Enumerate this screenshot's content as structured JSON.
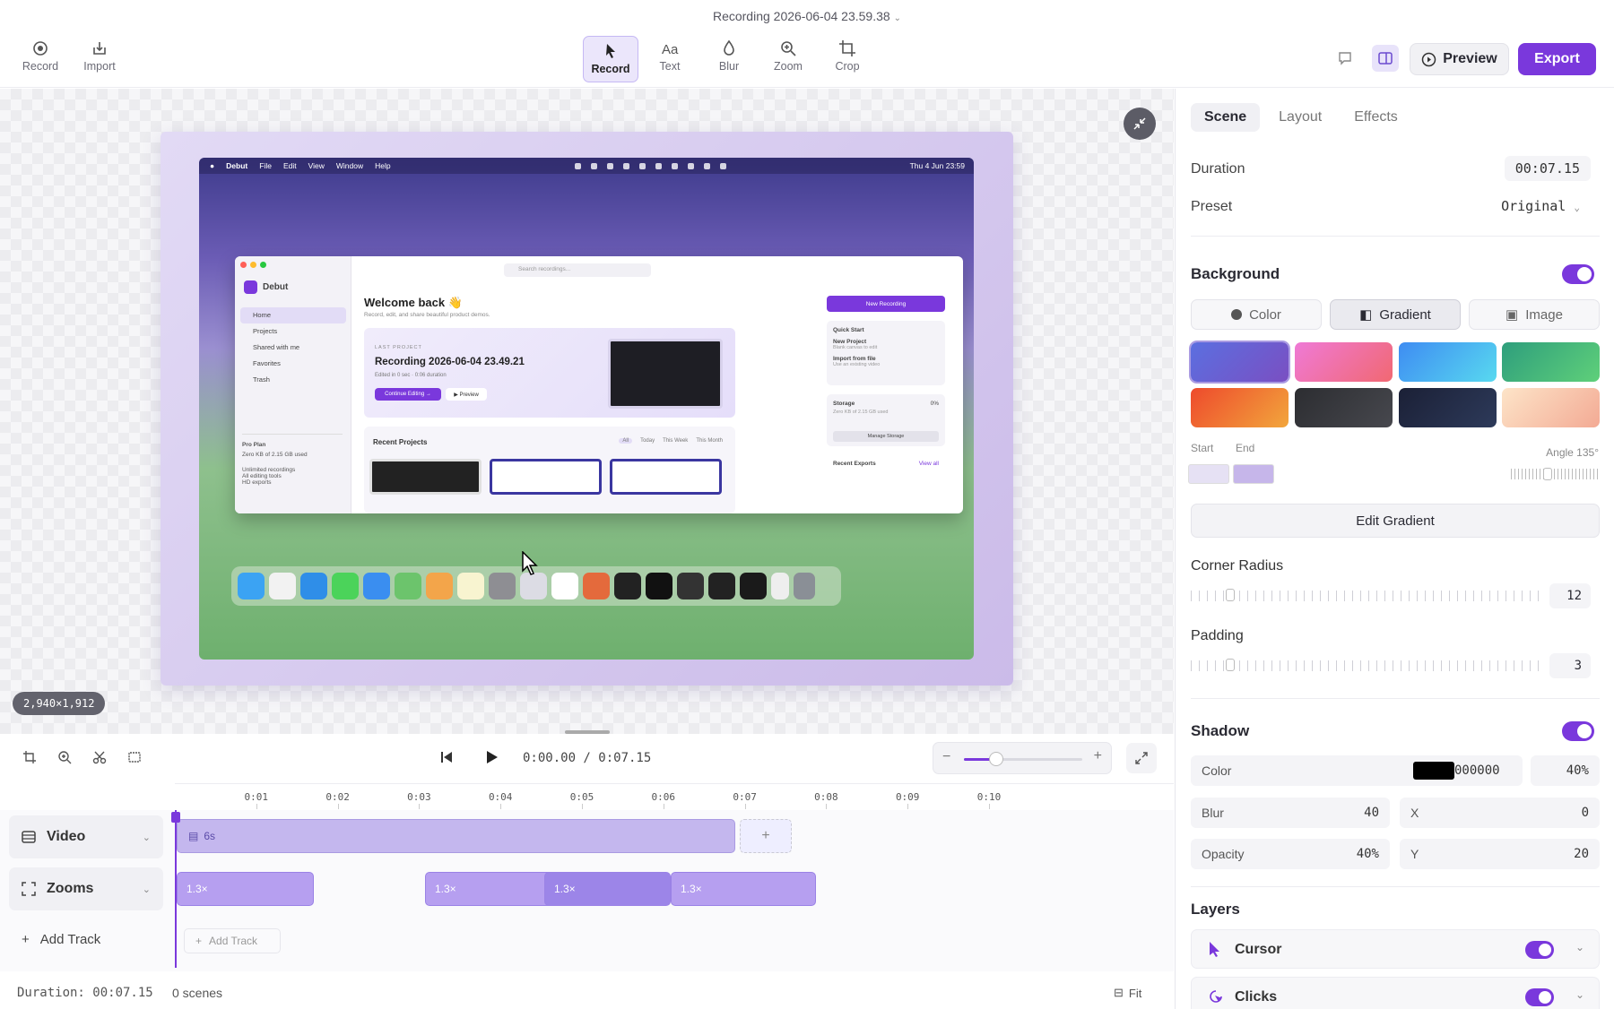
{
  "window_title": "Recording 2026-06-04 23.59.38",
  "toolbar": {
    "record": "Record",
    "import": "Import",
    "tools": [
      "Record",
      "Text",
      "Blur",
      "Zoom",
      "Crop"
    ],
    "preview": "Preview",
    "export": "Export"
  },
  "canvas": {
    "dimensions": "2,940×1,912",
    "screen": {
      "menu": [
        "Debut",
        "File",
        "Edit",
        "View",
        "Window",
        "Help"
      ],
      "clock": "Thu 4 Jun 23:59",
      "app": {
        "brand": "Debut",
        "nav": [
          "Home",
          "Projects",
          "Shared with me",
          "Favorites",
          "Trash"
        ],
        "plan": "Pro Plan",
        "plan_usage": "Zero KB of 2.15 GB used",
        "plan_features": [
          "Unlimited recordings",
          "All editing tools",
          "HD exports"
        ],
        "search_placeholder": "Search recordings...",
        "welcome": "Welcome back 👋",
        "welcome_sub": "Record, edit, and share beautiful product demos.",
        "last_project_label": "LAST PROJECT",
        "last_project_name": "Recording 2026-06-04 23.49.21",
        "last_project_meta": "Edited in 0 sec  ·  0:06 duration",
        "continue": "Continue Editing →",
        "preview": "▶ Preview",
        "recent_title": "Recent Projects",
        "filters": [
          "All",
          "Today",
          "This Week",
          "This Month"
        ],
        "new_recording": "New Recording",
        "quick_start": "Quick Start",
        "qs_items": [
          "New Project",
          "Import from file"
        ],
        "qs_subs": [
          "Blank canvas to edit",
          "Use an existing video"
        ],
        "storage": "Storage",
        "storage_pct": "0%",
        "storage_usage": "Zero KB of 2.15 GB used",
        "manage_storage": "Manage Storage",
        "recent_exports": "Recent Exports",
        "view_all": "View all"
      }
    }
  },
  "timeline": {
    "time": "0:00.00 / 0:07.15",
    "zoom_level": 0.27,
    "ruler": [
      "0:01",
      "0:02",
      "0:03",
      "0:04",
      "0:05",
      "0:06",
      "0:07",
      "0:08",
      "0:09",
      "0:10"
    ],
    "tracks": [
      "Video",
      "Zooms"
    ],
    "add_track": "Add Track",
    "video_clip": "6s",
    "zoom_clips": [
      "1.3×",
      "1.3×",
      "1.3×",
      "1.3×"
    ],
    "status_duration": "Duration: 00:07.15",
    "status_scenes": "0 scenes",
    "fit": "Fit"
  },
  "panel": {
    "tabs": [
      "Scene",
      "Layout",
      "Effects"
    ],
    "duration_label": "Duration",
    "duration_value": "00:07.15",
    "preset_label": "Preset",
    "preset_value": "Original",
    "background_title": "Background",
    "bg_modes": [
      "Color",
      "Gradient",
      "Image"
    ],
    "start_label": "Start",
    "end_label": "End",
    "angle_label": "Angle 135°",
    "edit_gradient": "Edit Gradient",
    "corner_radius_label": "Corner Radius",
    "corner_radius_value": "12",
    "padding_label": "Padding",
    "padding_value": "3",
    "shadow_title": "Shadow",
    "shadow_color_label": "Color",
    "shadow_color_hex": "000000",
    "shadow_color_opacity": "40%",
    "blur_label": "Blur",
    "blur_value": "40",
    "x_label": "X",
    "x_value": "0",
    "opacity_label": "Opacity",
    "opacity_value": "40%",
    "y_label": "Y",
    "y_value": "20",
    "layers_title": "Layers",
    "layers": [
      "Cursor",
      "Clicks"
    ]
  },
  "colors": {
    "accent": "#7a38dc",
    "gradient_start": "#e6e1f4",
    "gradient_end": "#c6b6ea"
  }
}
